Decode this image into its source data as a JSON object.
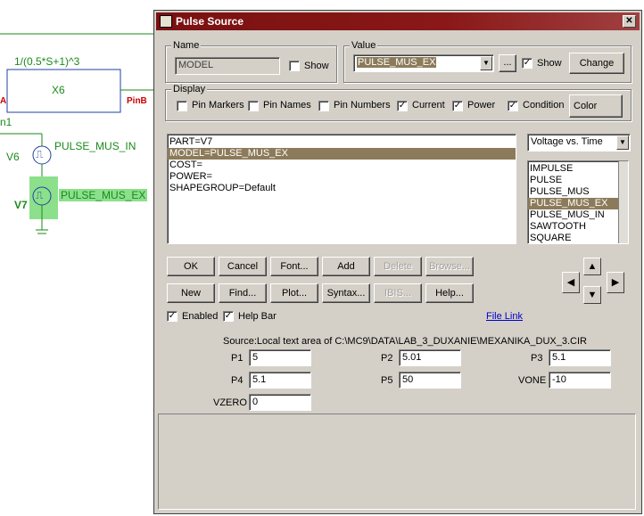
{
  "schematic": {
    "formula": "1/(0.5*S+1)^3",
    "block_label": "X6",
    "pin_b": "PinB",
    "pin_a": "A",
    "fragment_n1": "n1",
    "v6_label": "V6",
    "v6_model": "PULSE_MUS_IN",
    "v7_label": "V7",
    "v7_model": "PULSE_MUS_EX"
  },
  "dialog": {
    "title": "Pulse Source",
    "close_glyph": "✕",
    "name_group": "Name",
    "name_value": "MODEL",
    "name_show": "Show",
    "value_group": "Value",
    "value_value": "PULSE_MUS_EX",
    "value_ellipsis": "...",
    "value_show": "Show",
    "change_btn": "Change",
    "display_group": "Display",
    "display": {
      "pin_markers": "Pin Markers",
      "pin_names": "Pin Names",
      "pin_numbers": "Pin Numbers",
      "current": "Current",
      "power": "Power",
      "condition": "Condition",
      "color_btn": "Color"
    },
    "attributes": [
      "PART=V7",
      "MODEL=PULSE_MUS_EX",
      "COST=",
      "POWER=",
      "SHAPEGROUP=Default"
    ],
    "plot_mode": "Voltage vs. Time",
    "models": [
      "IMPULSE",
      "PULSE",
      "PULSE_MUS",
      "PULSE_MUS_EX",
      "PULSE_MUS_IN",
      "SAWTOOTH",
      "SQUARE"
    ],
    "buttons_row1": [
      "OK",
      "Cancel",
      "Font...",
      "Add",
      "Delete",
      "Browse..."
    ],
    "buttons_row2": [
      "New",
      "Find...",
      "Plot...",
      "Syntax...",
      "IBIS...",
      "Help..."
    ],
    "enabled": "Enabled",
    "help_bar": "Help Bar",
    "file_link": "File Link",
    "source": "Source:Local text area of C:\\MC9\\DATA\\LAB_3_DUXANIE\\MEXANIKA_DUX_3.CIR",
    "params": {
      "p1_label": "P1",
      "p1": "5",
      "p2_label": "P2",
      "p2": "5.01",
      "p3_label": "P3",
      "p3": "5.1",
      "p4_label": "P4",
      "p4": "5.1",
      "p5_label": "P5",
      "p5": "50",
      "vone_label": "VONE",
      "vone": "-10",
      "vzero_label": "VZERO",
      "vzero": "0"
    },
    "check_glyph": "✓",
    "arrows": {
      "up": "▲",
      "down": "▼",
      "left": "◀",
      "right": "▶"
    },
    "combo_arrow": "▼"
  },
  "colors": {
    "titlebar": "#7a1010",
    "selection": "#8c7b5a",
    "schematic_green": "#1a8a1a",
    "wire_blue": "#2040a0",
    "pin_red": "#cc0000"
  }
}
